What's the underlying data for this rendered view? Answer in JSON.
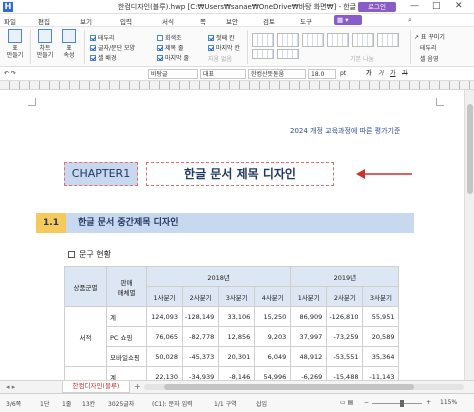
{
  "titlebar": {
    "logo": "H",
    "title": "한컴디자인(블루).hwp [C:₩Users₩sanae₩OneDrive₩바탕 화면₩] - 한글",
    "login": "로그인",
    "minimize": "—",
    "maximize": "□",
    "close": "✕"
  },
  "menubar": {
    "items": [
      "파일",
      "편집",
      "보기",
      "입력",
      "서식",
      "쪽",
      "보안",
      "검토",
      "도구"
    ],
    "search_icon": "search-icon",
    "search_glyph": "⌕"
  },
  "ribbon": {
    "buttons": [
      {
        "label": "표\n만들기"
      },
      {
        "label": "차트\n만들기"
      },
      {
        "label": "표\n속성"
      }
    ],
    "checks": [
      {
        "label": "테두리",
        "checked": true
      },
      {
        "label": "글자/문단 모양",
        "checked": true
      },
      {
        "label": "셀 배경",
        "checked": true
      },
      {
        "label": "회색조",
        "checked": false
      },
      {
        "label": "제목 줄",
        "checked": true
      },
      {
        "label": "마지막 줄",
        "checked": true
      },
      {
        "label": "첫째 칸",
        "checked": true
      },
      {
        "label": "마지막 칸",
        "checked": true
      },
      {
        "label": "지움 없음",
        "checked": false
      }
    ],
    "style_group_label": "표 스타일",
    "right_items": [
      "표 꾸미기",
      "테두리",
      "셀 음영"
    ],
    "right_prefix": "↗ 표 꾸미기",
    "right_label_2": "테두리",
    "right_label_3": "셀 음영",
    "gray_label": "기본 나눔"
  },
  "formatbar": {
    "style": "바탕글",
    "lang": "대표",
    "font": "한컴산뜻돋움",
    "size": "18.0",
    "unit": "pt",
    "bold": "가",
    "italic": "가",
    "underline": "가",
    "strike": "가"
  },
  "document": {
    "running_head": "2024 개정 교육과정에 따른 평가기준",
    "chapter": "CHAPTER1",
    "title": "한글 문서 제목 디자인",
    "section_num": "1.1",
    "section_title": "한글 문서 중간제목 디자인",
    "subhead": "문구 현황",
    "table": {
      "h_group": "상품군별",
      "h_channel": "판매\n매체별",
      "year1": "2018년",
      "year2": "2019년",
      "quarters": [
        "1사분기",
        "2사분기",
        "3사분기",
        "4사분기",
        "1사분기",
        "2사분기",
        "3사분기"
      ],
      "category": "서적",
      "rows": [
        {
          "label": "계",
          "values": [
            "124,093",
            "-128,149",
            "33,106",
            "15,250",
            "86,909",
            "-126,810",
            "55,951"
          ]
        },
        {
          "label": "PC 쇼핑",
          "values": [
            "76,065",
            "-82,778",
            "12,856",
            "9,203",
            "37,997",
            "-73,259",
            "20,589"
          ]
        },
        {
          "label": "모바일쇼핑",
          "values": [
            "50,028",
            "-45,373",
            "20,301",
            "6,049",
            "48,912",
            "-53,551",
            "35,364"
          ]
        },
        {
          "label": "계",
          "values": [
            "22,130",
            "-34,939",
            "-8,146",
            "54,996",
            "-6,269",
            "-15,488",
            "-11,143"
          ]
        }
      ]
    }
  },
  "tabbar": {
    "nav": "◂ ▸",
    "tab": "한컴디자인(블루)",
    "add": "+"
  },
  "statusbar": {
    "page": "3/6쪽",
    "section": "1단",
    "line": "1줄",
    "col": "13칸",
    "chars": "3025글자",
    "mode": "(C1): 문자 입력",
    "area": "1/1 구역",
    "insert": "삽입",
    "zoom": "115%"
  }
}
